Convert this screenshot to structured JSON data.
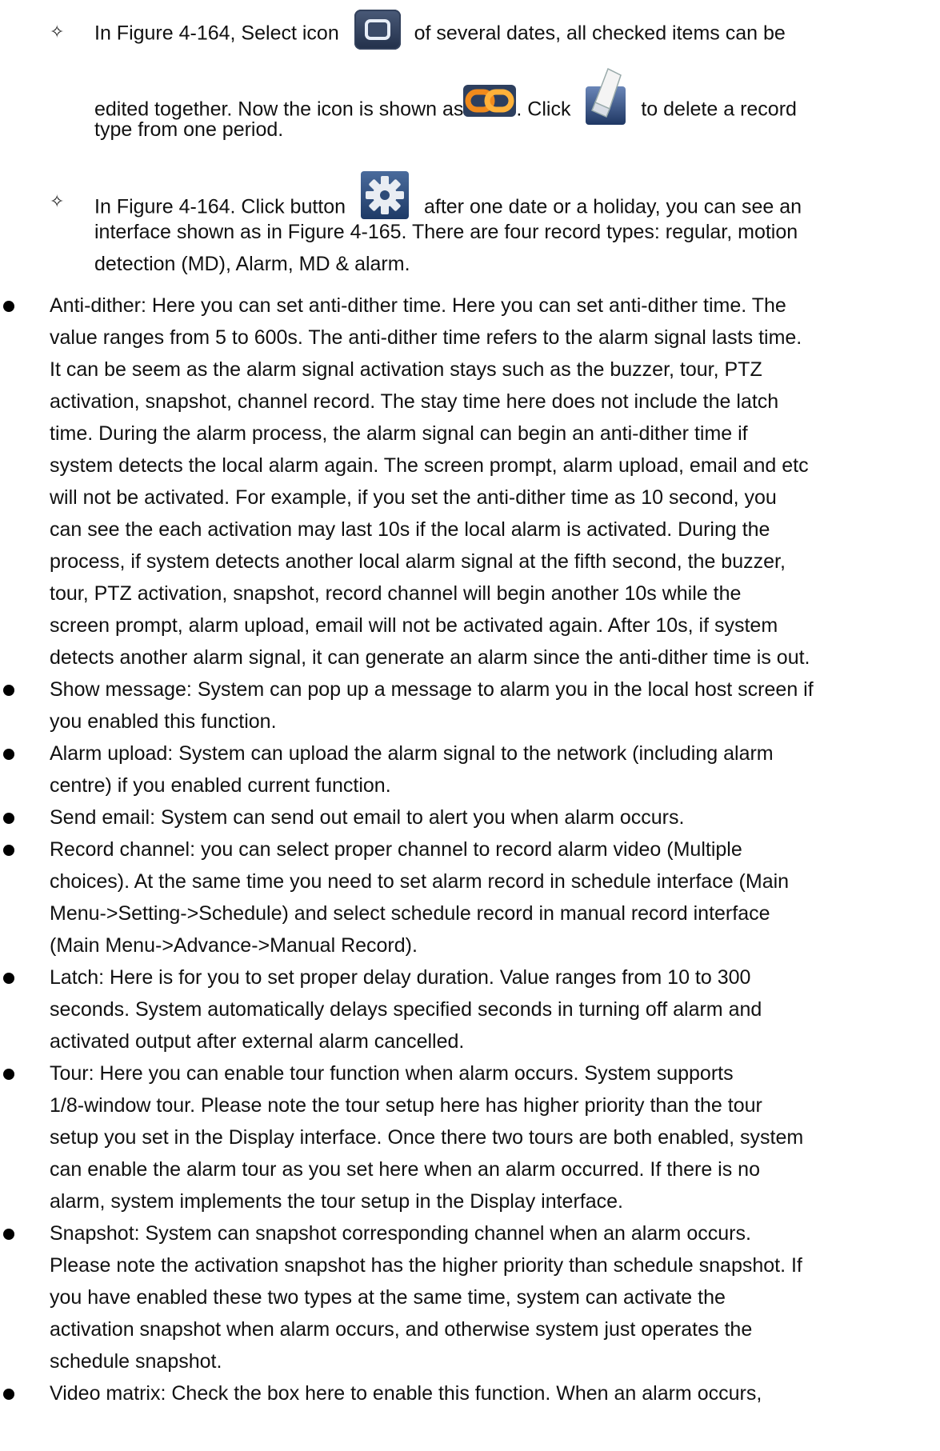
{
  "sub_items": [
    {
      "mark": "✧",
      "part_a": "In Figure 4-164, Select icon",
      "part_b": "of several dates, all checked items can be",
      "part_c": "edited together. Now the icon is shown as",
      "part_d": ". Click",
      "part_e": "to delete a record",
      "part_f": "type from one period."
    },
    {
      "mark": "✧",
      "part_a": "In Figure 4-164. Click button",
      "part_b": "after one date or a holiday, you can see an",
      "line2": "interface shown as in Figure 4-165. There are four record types: regular, motion",
      "line3": "detection (MD), Alarm, MD & alarm."
    }
  ],
  "icons": {
    "select": "window-select-icon",
    "link": "chain-link-icon",
    "erase": "eraser-icon",
    "gear": "gear-icon"
  },
  "bullets": [
    {
      "lines": [
        "Anti-dither: Here you can set anti-dither time. Here you can set anti-dither time. The",
        "value ranges from 5 to 600s. The anti-dither time refers to the alarm signal lasts time.",
        "It can be seem as the alarm signal activation stays such as the buzzer, tour, PTZ",
        "activation, snapshot, channel record. The stay time here does not include the latch",
        "time. During the alarm process, the alarm signal can begin an anti-dither time if",
        "system detects the local alarm again. The screen prompt, alarm upload, email and etc",
        "will not be activated. For example, if you set the anti-dither time as 10 second, you",
        "can see the each activation may last 10s if the local alarm is activated. During the",
        "process, if system detects another local alarm signal at the fifth second, the buzzer,",
        "tour, PTZ   activation, snapshot, record channel will begin another 10s while the",
        "screen prompt, alarm upload, email will not be activated again. After 10s, if system",
        "detects another alarm signal, it can generate an alarm since the anti-dither time is out."
      ]
    },
    {
      "lines": [
        "Show message: System can pop up a message to alarm you in the local host screen if",
        "you enabled this function."
      ]
    },
    {
      "lines": [
        "Alarm upload: System can upload the alarm signal to the network (including alarm",
        "centre) if you enabled current function."
      ]
    },
    {
      "lines": [
        "Send email: System can send out email to alert you when alarm occurs."
      ]
    },
    {
      "lines": [
        "Record channel: you can select proper channel to record alarm video (Multiple",
        "choices). At the same time you need to set alarm record in schedule interface (Main",
        "Menu->Setting->Schedule) and select schedule record in manual record interface",
        "(Main Menu->Advance->Manual Record)."
      ]
    },
    {
      "lines": [
        "Latch: Here is for you to set proper delay duration. Value ranges from 10 to 300",
        "seconds. System automatically delays specified seconds in turning off alarm and",
        "activated output after external alarm cancelled."
      ]
    },
    {
      "lines": [
        "Tour: Here you can enable tour function when alarm occurs. System supports",
        "1/8-window tour. Please note the tour setup here has higher priority than the tour",
        "setup you set in the Display interface. Once there two tours are both enabled, system",
        "can enable the alarm tour as you set here when an alarm occurred. If there is no",
        "alarm, system implements the tour setup in the Display interface."
      ]
    },
    {
      "lines": [
        "Snapshot: System can snapshot corresponding channel when an alarm occurs.",
        "Please note the activation snapshot has the higher priority than schedule snapshot. If",
        "you have enabled these two types at the same time, system can activate the",
        "activation snapshot when alarm occurs, and otherwise system just operates the",
        "schedule snapshot."
      ]
    },
    {
      "lines": [
        "Video matrix: Check the box here to enable this function. When an alarm occurs,"
      ]
    }
  ]
}
